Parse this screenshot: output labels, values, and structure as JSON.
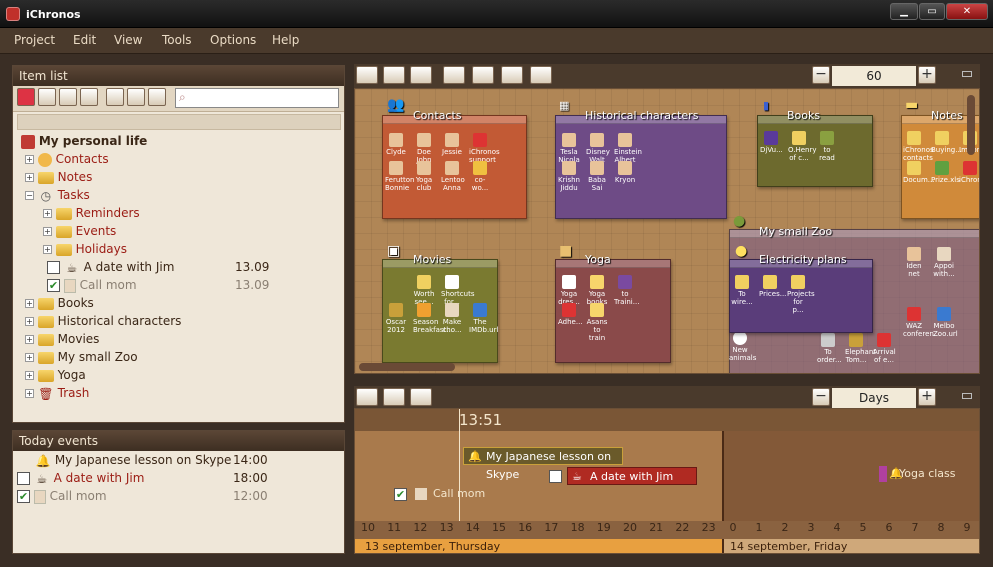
{
  "window": {
    "title": "iChronos"
  },
  "menu": [
    "Project",
    "Edit",
    "View",
    "Tools",
    "Options",
    "Help"
  ],
  "item_list": {
    "header": "Item list",
    "search_placeholder": "",
    "root": "My personal life",
    "rows": [
      {
        "label": "Contacts",
        "cls": "red"
      },
      {
        "label": "Notes",
        "cls": "red"
      },
      {
        "label": "Tasks",
        "cls": "red"
      },
      {
        "label": "Reminders",
        "cls": "red"
      },
      {
        "label": "Events",
        "cls": "red"
      },
      {
        "label": "Holidays",
        "cls": "red"
      },
      {
        "label": "A date with Jim",
        "date": "13.09"
      },
      {
        "label": "Call mom",
        "date": "13.09"
      },
      {
        "label": "Books"
      },
      {
        "label": "Historical characters"
      },
      {
        "label": "Movies"
      },
      {
        "label": "My small Zoo"
      },
      {
        "label": "Yoga"
      },
      {
        "label": "Trash",
        "cls": "red"
      }
    ]
  },
  "today_events": {
    "header": "Today events",
    "rows": [
      {
        "label": "My Japanese lesson on Skype",
        "time": "14:00"
      },
      {
        "label": "A date with Jim",
        "time": "18:00"
      },
      {
        "label": "Call mom",
        "time": "12:00"
      }
    ]
  },
  "board": {
    "zoom": "60",
    "groups": {
      "contacts": {
        "title": "Contacts",
        "items": [
          "Clyde",
          "Doe John",
          "Jessie",
          "iChronos support",
          "Ferutton Bonnie",
          "Yoga club",
          "Lentoo Anna",
          "co-wo..."
        ]
      },
      "historical": {
        "title": "Historical characters",
        "items": [
          "Tesla Nicola",
          "Disney Walt",
          "Einstein Albert",
          "Krishn Jiddu",
          "Baba Sai",
          "Kryon"
        ]
      },
      "books": {
        "title": "Books",
        "items": [
          "DjVu...",
          "O.Henry of c...",
          "to read"
        ]
      },
      "notes": {
        "title": "Notes",
        "items": [
          "iChronos contacts",
          "Buying...",
          "Import...",
          "Docum...",
          "Prize.xls",
          "iChronos..."
        ]
      },
      "zoo": {
        "title": "My small Zoo"
      },
      "movies": {
        "title": "Movies",
        "items": [
          "Worth see...",
          "Shortcuts for...",
          "Oscar 2012",
          "Season Breakfast...",
          "Make cho...",
          "The IMDb.url"
        ]
      },
      "yoga": {
        "title": "Yoga",
        "items": [
          "Yoga dres...",
          "Yoga books",
          "to Traini...",
          "Adhe...",
          "Asans to train"
        ]
      },
      "electricity": {
        "title": "Electricity plans",
        "items": [
          "To wire...",
          "Prices...",
          "Projects for p..."
        ]
      },
      "zoo_items": [
        "Iden net",
        "Appoi with...",
        "WAZ conferen...",
        "Melbo Zoo.url",
        "New animals",
        "To order...",
        "Elephant Tom...",
        "Arrival of e..."
      ]
    }
  },
  "timeline": {
    "scale": "Days",
    "now": "13:51",
    "hours_day1": [
      "10",
      "11",
      "12",
      "13",
      "14",
      "15",
      "16",
      "17",
      "18",
      "19",
      "20",
      "21",
      "22",
      "23"
    ],
    "hours_day2": [
      "0",
      "1",
      "2",
      "3",
      "4",
      "5",
      "6",
      "7",
      "8",
      "9"
    ],
    "day1": "13 september, Thursday",
    "day2": "14 september, Friday",
    "events": {
      "japanese": "My Japanese lesson on Skype",
      "jim": "A date with Jim",
      "mom": "Call mom",
      "yoga": "Yoga class"
    }
  }
}
